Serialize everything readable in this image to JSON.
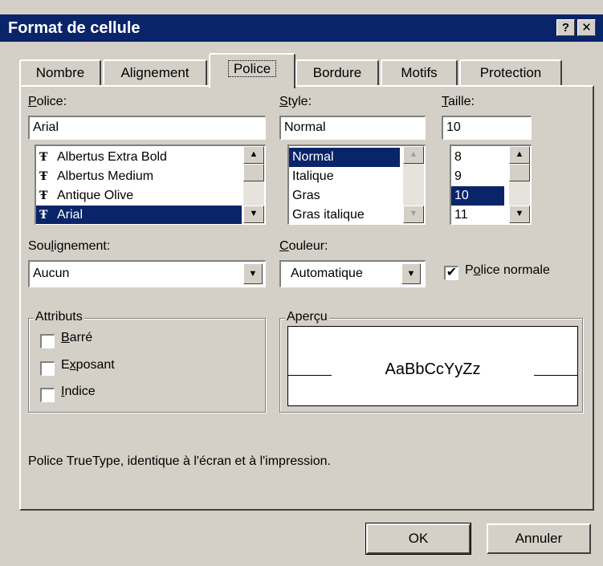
{
  "window": {
    "title": "Format de cellule",
    "help_btn": "?",
    "close_btn": "✕"
  },
  "tabs": [
    {
      "label": "Nombre"
    },
    {
      "label": "Alignement"
    },
    {
      "label": "Police",
      "active": true
    },
    {
      "label": "Bordure"
    },
    {
      "label": "Motifs"
    },
    {
      "label": "Protection"
    }
  ],
  "font": {
    "label_u": "P",
    "label_rest": "olice:",
    "value": "Arial",
    "items": [
      {
        "icon": "Ŧ",
        "name": "Albertus Extra Bold"
      },
      {
        "icon": "Ŧ",
        "name": "Albertus Medium"
      },
      {
        "icon": "Ŧ",
        "name": "Antique Olive"
      },
      {
        "icon": "Ŧ",
        "name": "Arial",
        "selected": true
      }
    ]
  },
  "style": {
    "label_u": "S",
    "label_rest": "tyle:",
    "value": "Normal",
    "items": [
      {
        "name": "Normal",
        "selected": true
      },
      {
        "name": "Italique"
      },
      {
        "name": "Gras"
      },
      {
        "name": "Gras italique"
      }
    ]
  },
  "size": {
    "label_u": "T",
    "label_rest": "aille:",
    "value": "10",
    "items": [
      {
        "name": "8"
      },
      {
        "name": "9"
      },
      {
        "name": "10",
        "selected": true
      },
      {
        "name": "11"
      }
    ]
  },
  "underline": {
    "label_a": "Sou",
    "label_u": "l",
    "label_b": "ignement:",
    "value": "Aucun"
  },
  "color": {
    "label_u": "C",
    "label_rest": "ouleur:",
    "value": "Automatique"
  },
  "normal_font": {
    "label_a": "P",
    "label_u": "o",
    "label_b": "lice normale",
    "checked": true,
    "mark": "✔"
  },
  "attributes": {
    "title": "Attributs",
    "barre": {
      "u": "B",
      "rest": "arré",
      "checked": false
    },
    "exposant": {
      "a": "E",
      "u": "x",
      "b": "posant",
      "checked": false
    },
    "indice": {
      "u": "I",
      "rest": "ndice",
      "checked": false
    }
  },
  "preview": {
    "title": "Aperçu",
    "sample": "AaBbCcYyZz"
  },
  "description": "Police TrueType, identique à l'écran et à l'impression.",
  "buttons": {
    "ok": "OK",
    "cancel": "Annuler"
  },
  "arrows": {
    "up": "▲",
    "down": "▼"
  },
  "colors": {
    "titlebar": "#0a246a",
    "selection": "#0a246a",
    "face": "#d4d0c8"
  }
}
